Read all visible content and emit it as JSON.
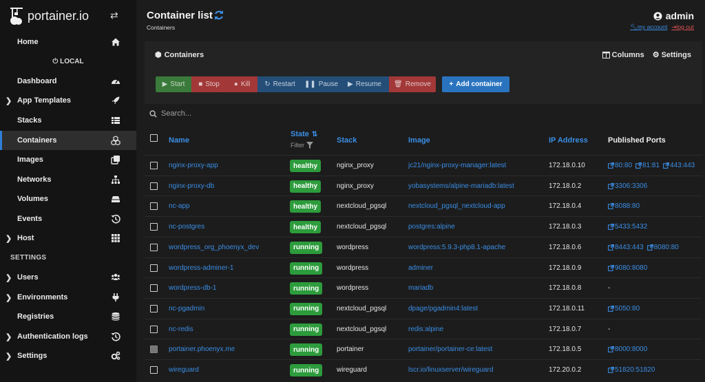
{
  "app": {
    "logo_text": "portainer.io"
  },
  "sidebar": {
    "environment_label": "LOCAL",
    "settings_heading": "SETTINGS",
    "items": [
      {
        "label": "Home",
        "icon": "home-icon",
        "caret": false,
        "active": false
      },
      {
        "label": "Dashboard",
        "icon": "dashboard-gauge-icon",
        "caret": false,
        "active": false
      },
      {
        "label": "App Templates",
        "icon": "rocket-icon",
        "caret": true,
        "active": false
      },
      {
        "label": "Stacks",
        "icon": "list-grid-icon",
        "caret": false,
        "active": false
      },
      {
        "label": "Containers",
        "icon": "cubes-icon",
        "caret": false,
        "active": true
      },
      {
        "label": "Images",
        "icon": "clone-icon",
        "caret": false,
        "active": false
      },
      {
        "label": "Networks",
        "icon": "sitemap-icon",
        "caret": false,
        "active": false
      },
      {
        "label": "Volumes",
        "icon": "hdd-icon",
        "caret": false,
        "active": false
      },
      {
        "label": "Events",
        "icon": "history-icon",
        "caret": false,
        "active": false
      },
      {
        "label": "Host",
        "icon": "grid-icon",
        "caret": true,
        "active": false
      },
      {
        "label": "Users",
        "icon": "users-icon",
        "caret": true,
        "active": false
      },
      {
        "label": "Environments",
        "icon": "plug-icon",
        "caret": true,
        "active": false
      },
      {
        "label": "Registries",
        "icon": "database-icon",
        "caret": false,
        "active": false
      },
      {
        "label": "Authentication logs",
        "icon": "history-icon",
        "caret": true,
        "active": false
      },
      {
        "label": "Settings",
        "icon": "cogs-icon",
        "caret": true,
        "active": false
      }
    ]
  },
  "header": {
    "title": "Container list",
    "breadcrumb": "Containers",
    "username": "admin",
    "my_account": "my account",
    "log_out": "log out"
  },
  "panel": {
    "title": "Containers",
    "columns_label": "Columns",
    "settings_label": "Settings"
  },
  "toolbar": {
    "start": "Start",
    "stop": "Stop",
    "kill": "Kill",
    "restart": "Restart",
    "pause": "Pause",
    "resume": "Resume",
    "remove": "Remove",
    "add_container": "Add container"
  },
  "search": {
    "placeholder": "Search..."
  },
  "table": {
    "columns": {
      "name": "Name",
      "state": "State",
      "filter": "Filter",
      "stack": "Stack",
      "image": "Image",
      "ip": "IP Address",
      "ports": "Published Ports"
    },
    "rows": [
      {
        "name": "nginx-proxy-app",
        "state": "healthy",
        "stack": "nginx_proxy",
        "image": "jc21/nginx-proxy-manager:latest",
        "ip": "172.18.0.10",
        "ports": [
          "80:80",
          "81:81",
          "443:443"
        ],
        "disabled": false
      },
      {
        "name": "nginx-proxy-db",
        "state": "healthy",
        "stack": "nginx_proxy",
        "image": "yobasystems/alpine-mariadb:latest",
        "ip": "172.18.0.2",
        "ports": [
          "3306:3306"
        ],
        "disabled": false
      },
      {
        "name": "nc-app",
        "state": "healthy",
        "stack": "nextcloud_pgsql",
        "image": "nextcloud_pgsql_nextcloud-app",
        "ip": "172.18.0.4",
        "ports": [
          "8088:80"
        ],
        "disabled": false
      },
      {
        "name": "nc-postgres",
        "state": "healthy",
        "stack": "nextcloud_pgsql",
        "image": "postgres:alpine",
        "ip": "172.18.0.3",
        "ports": [
          "5433:5432"
        ],
        "disabled": false
      },
      {
        "name": "wordpress_org_phoenyx_dev",
        "state": "running",
        "stack": "wordpress",
        "image": "wordpress:5.9.3-php8.1-apache",
        "ip": "172.18.0.6",
        "ports": [
          "8443:443",
          "8080:80"
        ],
        "disabled": false
      },
      {
        "name": "wordpress-adminer-1",
        "state": "running",
        "stack": "wordpress",
        "image": "adminer",
        "ip": "172.18.0.9",
        "ports": [
          "9080:8080"
        ],
        "disabled": false
      },
      {
        "name": "wordpress-db-1",
        "state": "running",
        "stack": "wordpress",
        "image": "mariadb",
        "ip": "172.18.0.8",
        "ports": [],
        "disabled": false
      },
      {
        "name": "nc-pgadmin",
        "state": "running",
        "stack": "nextcloud_pgsql",
        "image": "dpage/pgadmin4:latest",
        "ip": "172.18.0.11",
        "ports": [
          "5050:80"
        ],
        "disabled": false
      },
      {
        "name": "nc-redis",
        "state": "running",
        "stack": "nextcloud_pgsql",
        "image": "redis:alpine",
        "ip": "172.18.0.7",
        "ports": [],
        "disabled": false
      },
      {
        "name": "portainer.phoenyx.me",
        "state": "running",
        "stack": "portainer",
        "image": "portainer/portainer-ce:latest",
        "ip": "172.18.0.5",
        "ports": [
          "8000:8000"
        ],
        "disabled": true
      },
      {
        "name": "wireguard",
        "state": "running",
        "stack": "wireguard",
        "image": "lscr.io/linuxserver/wireguard",
        "ip": "172.20.0.2",
        "ports": [
          "51820:51820"
        ],
        "disabled": false
      }
    ],
    "empty_ports": "-"
  },
  "colors": {
    "accent": "#3a8ee6",
    "healthy": "#2d9c3c",
    "danger": "#a23838",
    "primary": "#2a74bf"
  }
}
